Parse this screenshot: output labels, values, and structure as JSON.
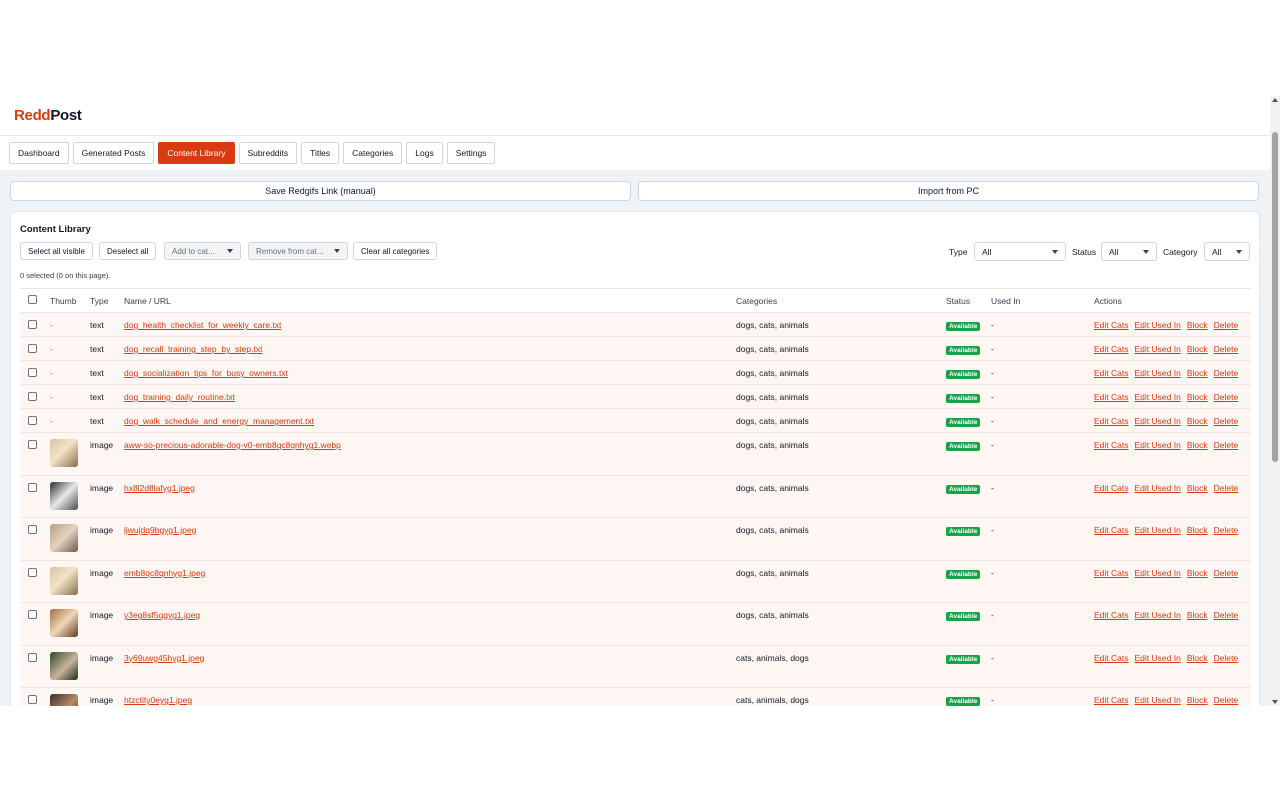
{
  "brand": {
    "part1": "Redd",
    "part2": "Post",
    "accent": "#d93a0f"
  },
  "tabs": [
    "Dashboard",
    "Generated Posts",
    "Content Library",
    "Subreddits",
    "Titles",
    "Categories",
    "Logs",
    "Settings"
  ],
  "active_tab": "Content Library",
  "actions": {
    "save_link": "Save Redgifs Link (manual)",
    "import_pc": "Import from PC"
  },
  "library": {
    "title": "Content Library",
    "toolbar": {
      "select_all": "Select all visible",
      "deselect_all": "Deselect all",
      "add_to_cat": "Add to cat...",
      "remove_from_cat": "Remove from cat...",
      "clear_all": "Clear all categories"
    },
    "filters": {
      "type_label": "Type",
      "type_value": "All",
      "status_label": "Status",
      "status_value": "All",
      "category_label": "Category",
      "category_value": "All"
    },
    "selection_text": "0 selected (0 on this page).",
    "columns": [
      "Thumb",
      "Type",
      "Name / URL",
      "Categories",
      "Status",
      "Used In",
      "Actions"
    ],
    "action_labels": [
      "Edit Cats",
      "Edit Used In",
      "Block",
      "Delete"
    ],
    "rows": [
      {
        "thumb": "-",
        "type": "text",
        "name": "dog_health_checklist_for_weekly_care.txt",
        "categories": "dogs, cats, animals",
        "status": "Available",
        "used_in": "-"
      },
      {
        "thumb": "-",
        "type": "text",
        "name": "dog_recall_training_step_by_step.txt",
        "categories": "dogs, cats, animals",
        "status": "Available",
        "used_in": "-"
      },
      {
        "thumb": "-",
        "type": "text",
        "name": "dog_socialization_tips_for_busy_owners.txt",
        "categories": "dogs, cats, animals",
        "status": "Available",
        "used_in": "-"
      },
      {
        "thumb": "-",
        "type": "text",
        "name": "dog_training_daily_routine.txt",
        "categories": "dogs, cats, animals",
        "status": "Available",
        "used_in": "-"
      },
      {
        "thumb": "-",
        "type": "text",
        "name": "dog_walk_schedule_and_energy_management.txt",
        "categories": "dogs, cats, animals",
        "status": "Available",
        "used_in": "-"
      },
      {
        "thumb": "image",
        "type": "image",
        "name": "aww-so-precious-adorable-dog-v0-emb8qc8qnhyg1.webp",
        "categories": "dogs, cats, animals",
        "status": "Available",
        "used_in": "-"
      },
      {
        "thumb": "image",
        "type": "image",
        "name": "hx8l2d8lafyg1.jpeg",
        "categories": "dogs, cats, animals",
        "status": "Available",
        "used_in": "-"
      },
      {
        "thumb": "image",
        "type": "image",
        "name": "ljwujdq9bgyg1.jpeg",
        "categories": "dogs, cats, animals",
        "status": "Available",
        "used_in": "-"
      },
      {
        "thumb": "image",
        "type": "image",
        "name": "emb8qc8qnhyg1.jpeg",
        "categories": "dogs, cats, animals",
        "status": "Available",
        "used_in": "-"
      },
      {
        "thumb": "image",
        "type": "image",
        "name": "y3eg8sf5qgyg1.jpeg",
        "categories": "dogs, cats, animals",
        "status": "Available",
        "used_in": "-"
      },
      {
        "thumb": "image",
        "type": "image",
        "name": "3y69uwg45hyg1.jpeg",
        "categories": "cats, animals, dogs",
        "status": "Available",
        "used_in": "-"
      },
      {
        "thumb": "image",
        "type": "image",
        "name": "htzctity0eyg1.jpeg",
        "categories": "cats, animals, dogs",
        "status": "Available",
        "used_in": "-"
      }
    ]
  },
  "colors": {
    "badge": "#16a34a",
    "link": "#d93a0f",
    "row_bg": "#fdf6f3"
  }
}
